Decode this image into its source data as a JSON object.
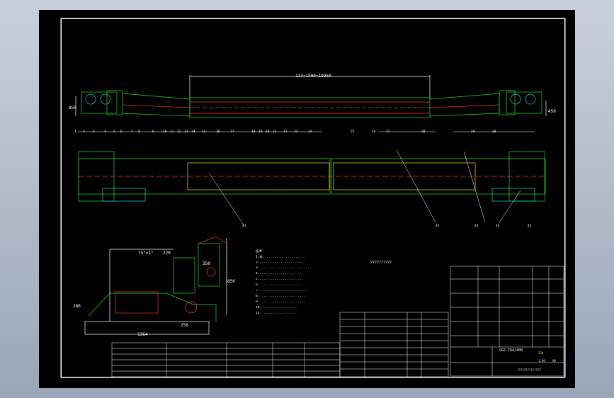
{
  "viewer": {
    "background_color": "#000000",
    "line_colors": {
      "outline": "#1fe01f",
      "detail": "#ff3030",
      "center": "#ffdd00",
      "white": "#ffffff",
      "cyan": "#00e0e0",
      "magenta": "#ff40ff"
    }
  },
  "drawing": {
    "top_dimension": "133×1500=19950",
    "side_dim_left": "850",
    "side_dim_right": "450",
    "balloon_numbers_top": [
      "1",
      "2",
      "3",
      "4",
      "5",
      "6",
      "7",
      "8",
      "9",
      "10",
      "11",
      "12",
      "13",
      "14",
      "15",
      "16",
      "17",
      "18",
      "19",
      "20",
      "21",
      "22",
      "23",
      "24",
      "25",
      "26",
      "27",
      "28",
      "29",
      "30"
    ],
    "balloon_numbers_bottom": [
      "41",
      "42",
      "43",
      "44",
      "45"
    ],
    "section": {
      "dim_width": "1364",
      "dim_220": "220",
      "dim_250": "250",
      "dim_850": "850",
      "dim_350": "350",
      "dim_angle": "75°±1°",
      "dim_height_left": "280"
    },
    "notes": {
      "title": "技术",
      "lines": [
        "1.本......................",
        "2........................",
        "3. ...........................",
        "4.......................",
        "5........................",
        "6.  ....................",
        "7. ........................",
        "8.  .......................",
        "9. .......................",
        "10.   ..................",
        "11.  ...........  ....."
      ],
      "callout": "??????????"
    },
    "parts_list_label": "??????????????",
    "title_block": {
      "name": "SGZ-764/400",
      "scale": "1:50",
      "sheet": "A0",
      "code": "ZGW"
    }
  }
}
